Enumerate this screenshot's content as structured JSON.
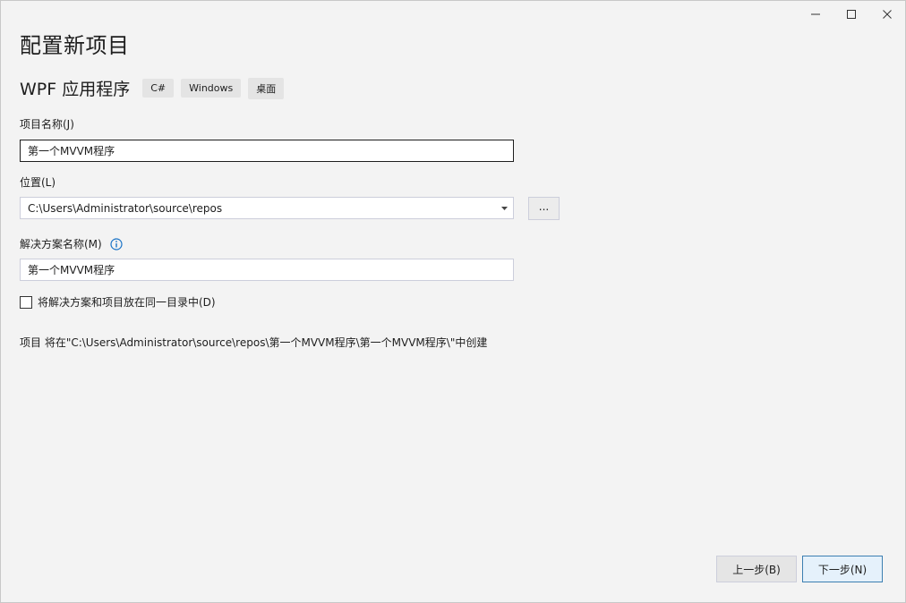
{
  "window": {
    "controls": [
      "minimize-icon",
      "maximize-icon",
      "close-icon"
    ]
  },
  "page": {
    "title": "配置新项目"
  },
  "template": {
    "name": "WPF 应用程序",
    "tags": [
      "C#",
      "Windows",
      "桌面"
    ]
  },
  "project_name": {
    "label": "项目名称(J)",
    "value": "第一个MVVM程序"
  },
  "location": {
    "label": "位置(L)",
    "value": "C:\\Users\\Administrator\\source\\repos",
    "browse_label": "..."
  },
  "solution_name": {
    "label": "解决方案名称(M)",
    "value": "第一个MVVM程序"
  },
  "same_dir": {
    "label": "将解决方案和项目放在同一目录中(D)",
    "checked": false
  },
  "path_note": "项目 将在\"C:\\Users\\Administrator\\source\\repos\\第一个MVVM程序\\第一个MVVM程序\\\"中创建",
  "buttons": {
    "back": "上一步(B)",
    "next": "下一步(N)"
  },
  "colors": {
    "background": "#f3f3f3",
    "info_icon": "#1a73c7",
    "next_border": "#3c7fb1"
  }
}
